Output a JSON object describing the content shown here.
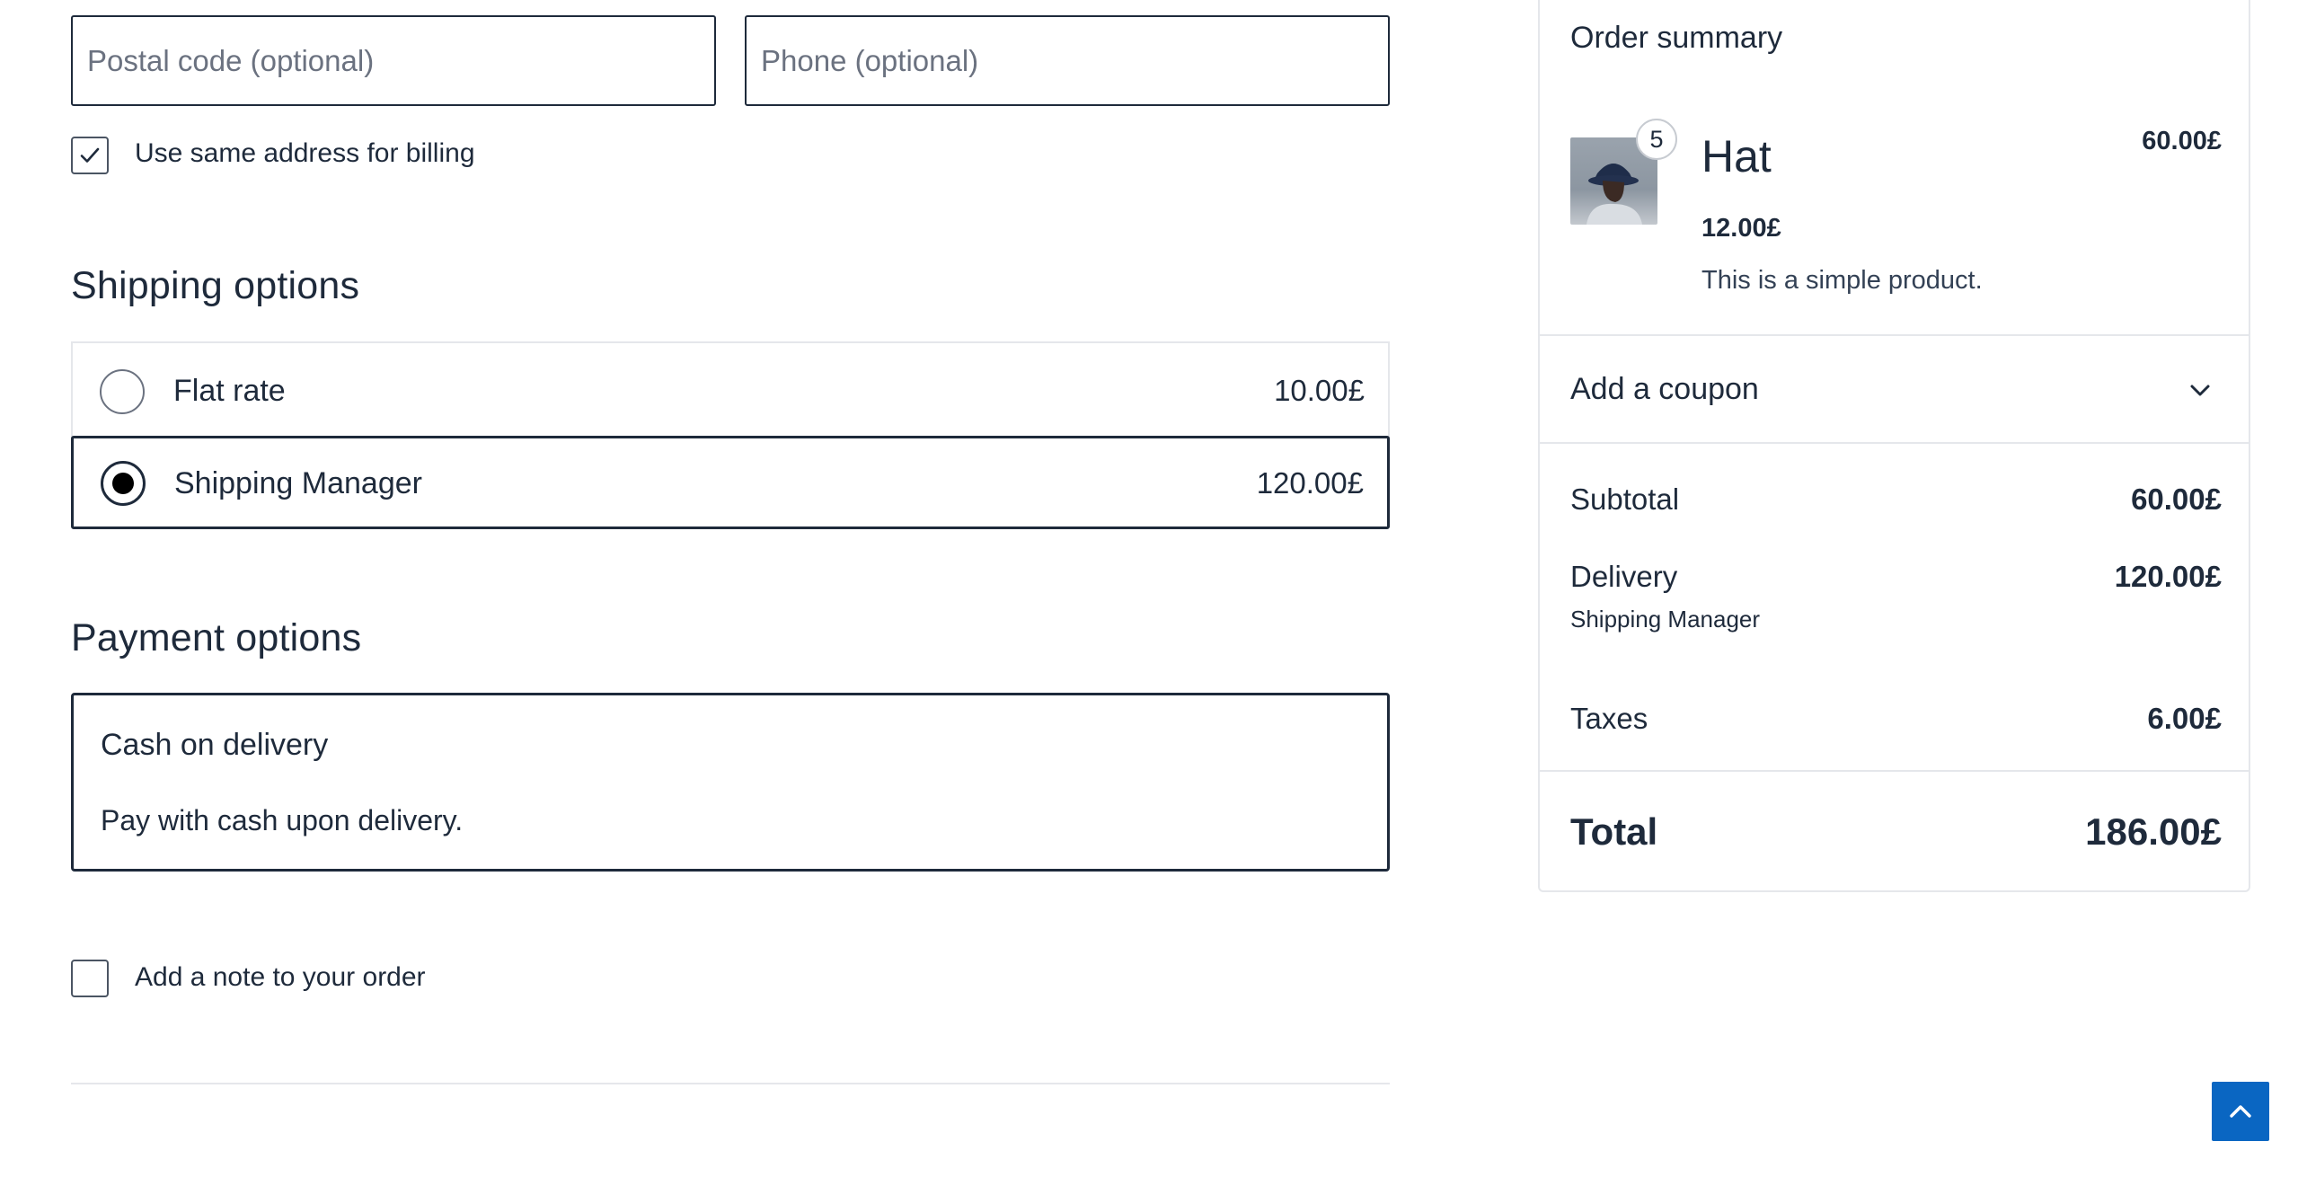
{
  "address": {
    "postal_placeholder": "Postal code (optional)",
    "phone_placeholder": "Phone (optional)",
    "same_billing_label": "Use same address for billing",
    "same_billing_checked": true
  },
  "shipping": {
    "heading": "Shipping options",
    "options": [
      {
        "label": "Flat rate",
        "price": "10.00£",
        "selected": false
      },
      {
        "label": "Shipping Manager",
        "price": "120.00£",
        "selected": true
      }
    ]
  },
  "payment": {
    "heading": "Payment options",
    "method_title": "Cash on delivery",
    "method_description": "Pay with cash upon delivery."
  },
  "note": {
    "label": "Add a note to your order",
    "checked": false
  },
  "summary": {
    "heading": "Order summary",
    "item": {
      "name": "Hat",
      "quantity": "5",
      "line_total": "60.00£",
      "unit_price": "12.00£",
      "description": "This is a simple product."
    },
    "coupon_label": "Add a coupon",
    "subtotal_label": "Subtotal",
    "subtotal_value": "60.00£",
    "delivery_label": "Delivery",
    "delivery_value": "120.00£",
    "delivery_method": "Shipping Manager",
    "taxes_label": "Taxes",
    "taxes_value": "6.00£",
    "total_label": "Total",
    "total_value": "186.00£"
  },
  "colors": {
    "text": "#1e2a3b",
    "border_light": "#e5e7eb",
    "scroll_top_button": "#0a66c2"
  },
  "icons": {
    "checkmark": "check-icon",
    "coupon_toggle": "chevron-down-icon",
    "scroll_top": "chevron-up-icon"
  }
}
